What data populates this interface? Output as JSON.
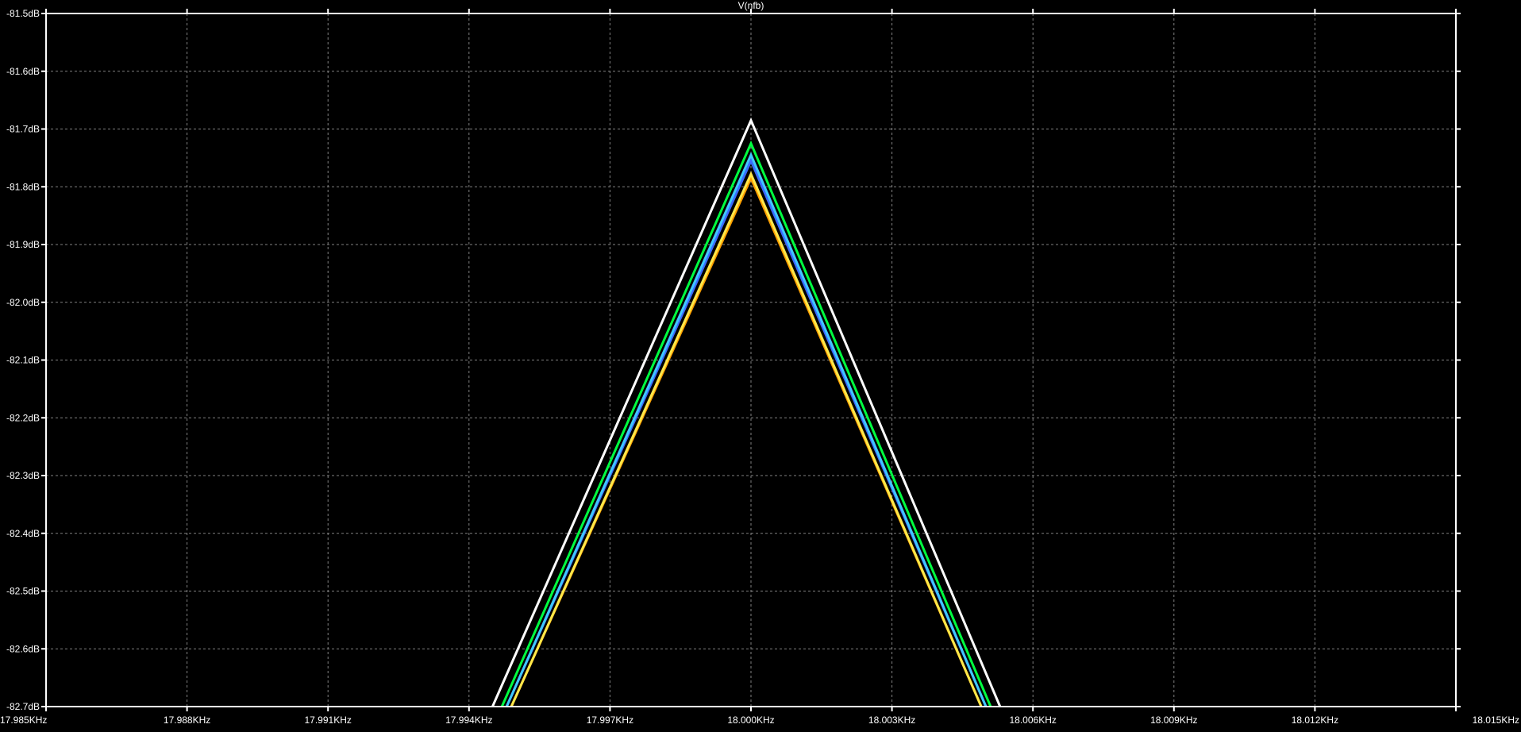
{
  "chart_data": {
    "type": "line",
    "title": "V(nfb)",
    "xlabel": "",
    "ylabel": "",
    "xlim": [
      17.985,
      18.015
    ],
    "ylim": [
      -82.7,
      -81.5
    ],
    "x_ticks": [
      17.985,
      17.988,
      17.991,
      17.994,
      17.997,
      18.0,
      18.003,
      18.006,
      18.009,
      18.012,
      18.015
    ],
    "x_tick_labels": [
      "17.985KHz",
      "17.988KHz",
      "17.991KHz",
      "17.994KHz",
      "17.997KHz",
      "18.000KHz",
      "18.003KHz",
      "18.006KHz",
      "18.009KHz",
      "18.012KHz",
      "18.015KHz"
    ],
    "y_ticks": [
      -81.5,
      -81.6,
      -81.7,
      -81.8,
      -81.9,
      -82.0,
      -82.1,
      -82.2,
      -82.3,
      -82.4,
      -82.5,
      -82.6,
      -82.7
    ],
    "y_tick_labels": [
      "-81.5dB",
      "-81.6dB",
      "-81.7dB",
      "-81.8dB",
      "-81.9dB",
      "-82.0dB",
      "-82.1dB",
      "-82.2dB",
      "-82.3dB",
      "-82.4dB",
      "-82.5dB",
      "-82.6dB",
      "-82.7dB"
    ],
    "grid": true,
    "background": "#000000",
    "frame_color": "#ffffff",
    "grid_color": "#808080",
    "series": [
      {
        "color": "#ffa000",
        "x": [
          17.9949,
          18.0,
          18.0049
        ],
        "y": [
          -82.7,
          -81.785,
          -82.7
        ]
      },
      {
        "color": "#ffe84a",
        "x": [
          17.9949,
          18.0,
          18.0049
        ],
        "y": [
          -82.7,
          -81.778,
          -82.7
        ]
      },
      {
        "color": "#3a6cff",
        "x": [
          17.9948,
          18.0,
          18.005
        ],
        "y": [
          -82.7,
          -81.755,
          -82.7
        ]
      },
      {
        "color": "#40c8ff",
        "x": [
          17.9948,
          18.0,
          18.005
        ],
        "y": [
          -82.7,
          -81.745,
          -82.7
        ]
      },
      {
        "color": "#00ff40",
        "x": [
          17.9947,
          18.0,
          18.0051
        ],
        "y": [
          -82.7,
          -81.725,
          -82.7
        ]
      },
      {
        "color": "#ffffff",
        "x": [
          17.9945,
          18.0,
          18.0053
        ],
        "y": [
          -82.7,
          -81.685,
          -82.7
        ]
      }
    ]
  }
}
